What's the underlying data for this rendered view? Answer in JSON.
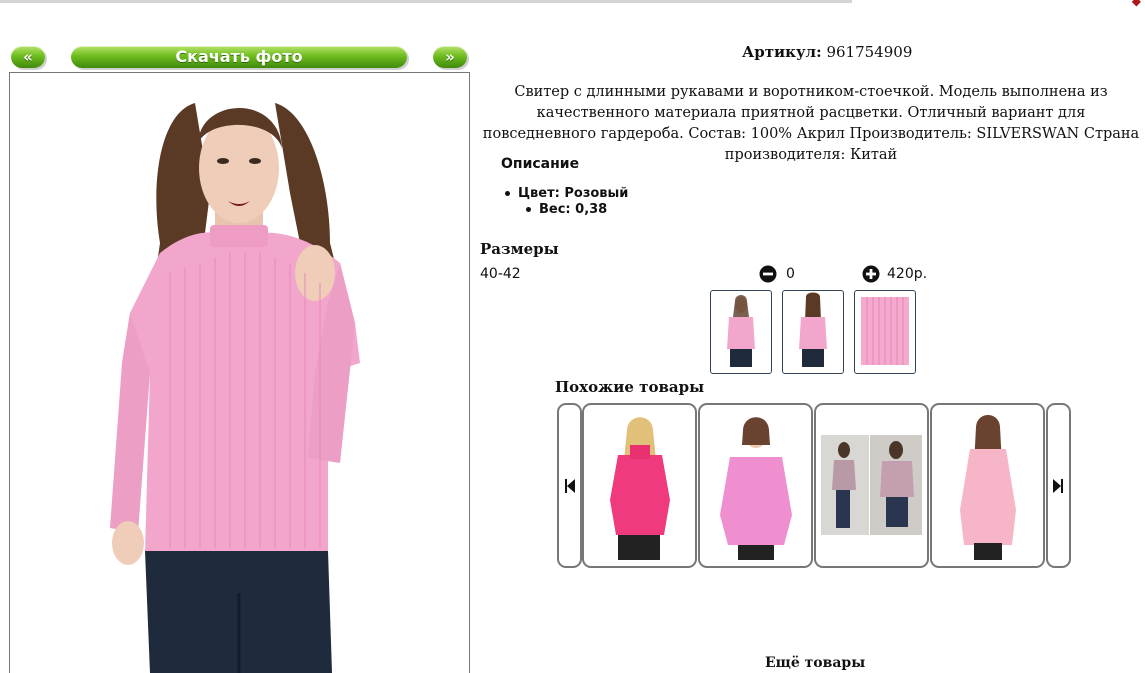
{
  "nav": {
    "prev_label": "«",
    "download_label": "Скачать фото",
    "next_label": "»"
  },
  "product": {
    "sku_label": "Артикул:",
    "sku_value": "961754909",
    "description": "Свитер с длинными рукавами и воротником-стоечкой. Модель выполнена из качественного материала приятной расцветки. Отличный вариант для повседневного гардероба. Состав: 100% Акрил Производитель: SILVERSWAN Страна производителя: Китай",
    "description_heading": "Описание",
    "color": "Цвет: Розовый",
    "weight": "Вес: 0,38",
    "main_color": "#f2a6cc"
  },
  "sizes": {
    "heading": "Размеры",
    "size": "40-42",
    "quantity": "0",
    "price": "420р."
  },
  "similar": {
    "heading": "Похожие товары"
  },
  "bottom": {
    "heading": "Ещё товары"
  },
  "icons": {
    "minus": "minus-circle-icon",
    "plus": "plus-circle-icon",
    "left": "skip-left-icon",
    "right": "skip-right-icon"
  }
}
